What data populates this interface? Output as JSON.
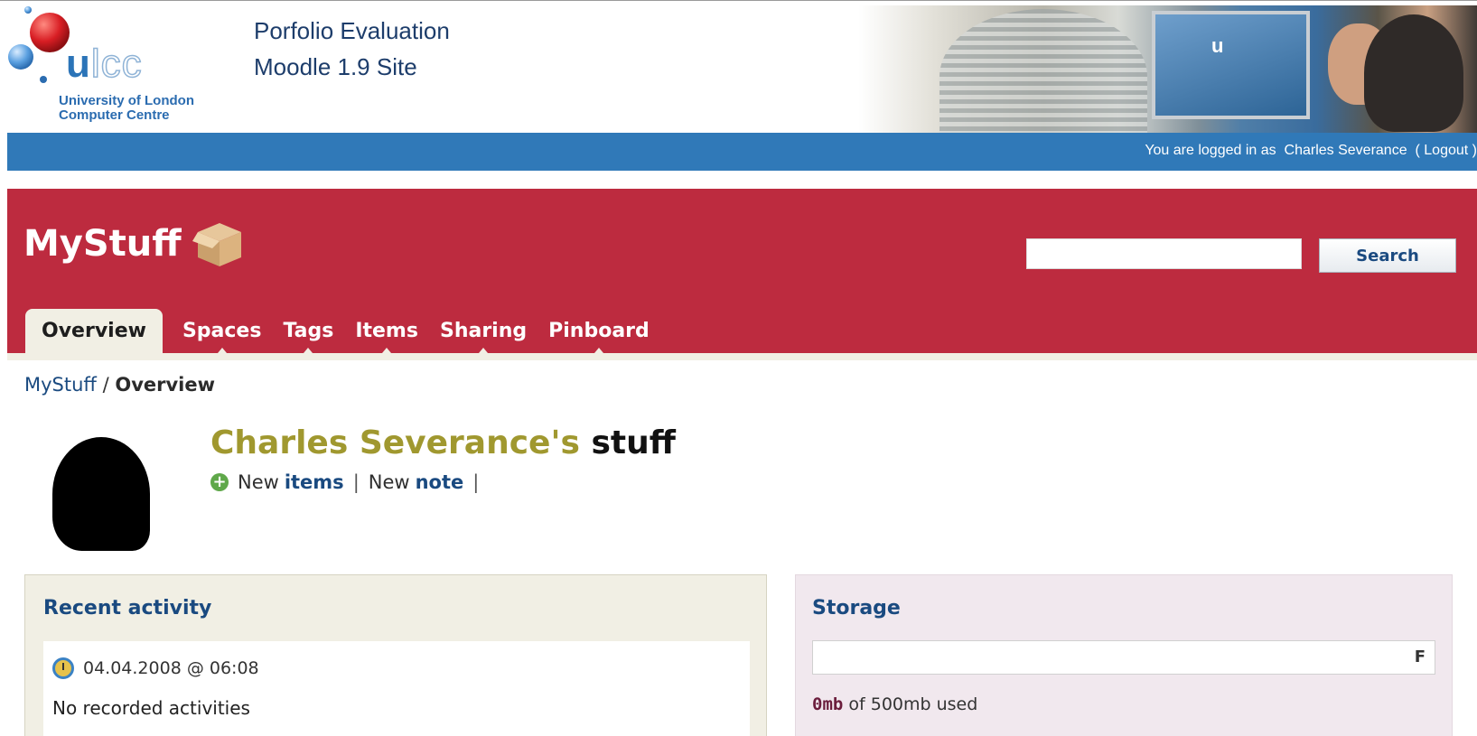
{
  "site": {
    "logo_text_bold": "u",
    "logo_text_outline": "lcc",
    "logo_subtitle_line1": "University of London",
    "logo_subtitle_line2": "Computer Centre",
    "title_line1": "Porfolio Evaluation",
    "title_line2": "Moodle 1.9 Site",
    "banner_mini_text": "u"
  },
  "login": {
    "prefix": "You are logged in as",
    "user": "Charles Severance",
    "logout_label": "Logout"
  },
  "mystuff": {
    "brand": "MyStuff",
    "search_value": "",
    "search_button": "Search",
    "tabs": [
      {
        "label": "Overview",
        "active": true
      },
      {
        "label": "Spaces",
        "active": false
      },
      {
        "label": "Tags",
        "active": false
      },
      {
        "label": "Items",
        "active": false
      },
      {
        "label": "Sharing",
        "active": false
      },
      {
        "label": "Pinboard",
        "active": false
      }
    ]
  },
  "breadcrumb": {
    "root": "MyStuff",
    "separator": "/",
    "current": "Overview"
  },
  "profile": {
    "owner": "Charles Severance's",
    "suffix": "stuff",
    "new_label_1": "New",
    "new_items": "items",
    "separator": "|",
    "new_label_2": "New",
    "new_note": "note"
  },
  "activity": {
    "title": "Recent activity",
    "timestamp": "04.04.2008 @ 06:08",
    "empty_text": "No recorded activities"
  },
  "storage": {
    "title": "Storage",
    "bar_letter": "F",
    "used_fraction": 0,
    "used": "0mb",
    "of_text": "of 500mb used"
  },
  "colors": {
    "header_blue": "#3079b8",
    "mystuff_red": "#bd2b3f",
    "tab_bg": "#f1efe4",
    "link_blue": "#1a4a80",
    "owner_olive": "#a0982f",
    "storage_bg": "#f1e8ee"
  }
}
